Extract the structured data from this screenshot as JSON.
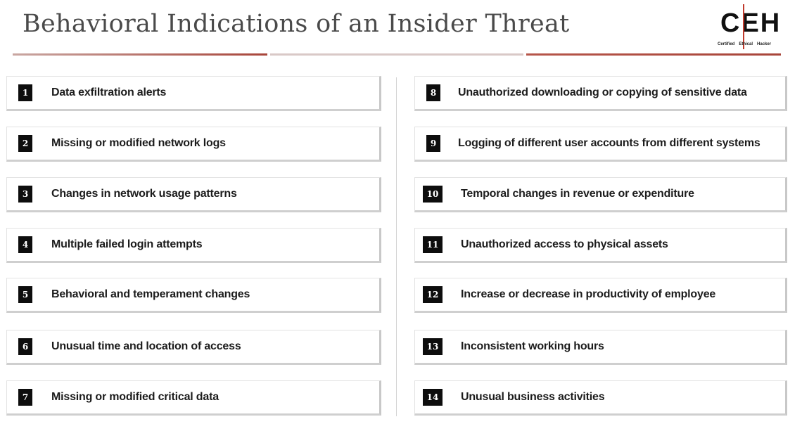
{
  "header": {
    "title": "Behavioral Indications of an Insider Threat",
    "logo": {
      "letters": "CEH",
      "sub": [
        "Certified",
        "Ethical",
        "Hacker"
      ]
    }
  },
  "colors": {
    "accent": "#a8453a",
    "number_box": "#0d0d0d"
  },
  "items": [
    {
      "num": "1",
      "text": "Data exfiltration alerts"
    },
    {
      "num": "2",
      "text": "Missing or modified network logs"
    },
    {
      "num": "3",
      "text": "Changes in network usage patterns"
    },
    {
      "num": "4",
      "text": "Multiple failed login attempts"
    },
    {
      "num": "5",
      "text": "Behavioral and temperament changes"
    },
    {
      "num": "6",
      "text": "Unusual time and location of access"
    },
    {
      "num": "7",
      "text": "Missing or modified critical data"
    },
    {
      "num": "8",
      "text": "Unauthorized downloading or copying of sensitive data"
    },
    {
      "num": "9",
      "text": "Logging of different user accounts from different systems"
    },
    {
      "num": "10",
      "text": "Temporal changes in revenue or expenditure"
    },
    {
      "num": "11",
      "text": "Unauthorized access to physical assets"
    },
    {
      "num": "12",
      "text": "Increase or decrease in productivity of employee"
    },
    {
      "num": "13",
      "text": "Inconsistent working hours"
    },
    {
      "num": "14",
      "text": "Unusual business activities"
    }
  ]
}
